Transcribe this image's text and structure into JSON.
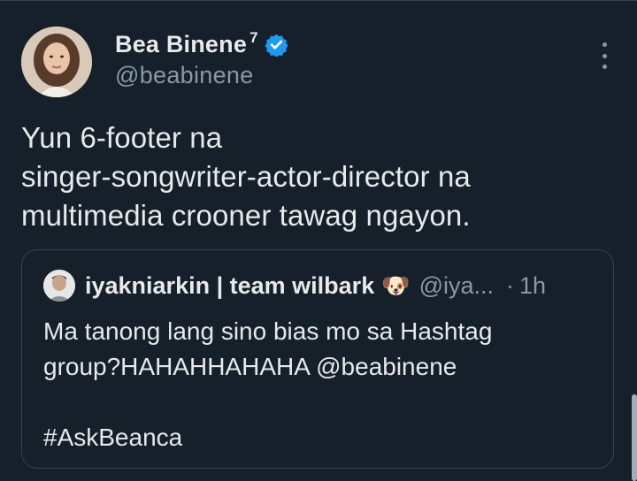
{
  "tweet": {
    "author_name": "Bea Binene",
    "author_superscript": "7",
    "author_handle": "@beabinene",
    "verified_icon": "verified-badge-icon",
    "more_icon": "more-vertical-icon",
    "text_lines": [
      "Yun 6-footer na",
      "singer-songwriter-actor-director na",
      "multimedia crooner tawag ngayon."
    ]
  },
  "quote": {
    "author_name": "iyakniarkin | team wilbark",
    "author_emoji": "🐶",
    "author_handle": "@iya...",
    "separator": "·",
    "time": "1h",
    "text_lines": [
      "Ma tanong lang sino bias mo sa Hashtag",
      "group?HAHAHHAHAHA @beabinene",
      "",
      "#AskBeanca"
    ]
  },
  "colors": {
    "background": "#15202b",
    "text": "#e7e9ea",
    "secondary": "#8b98a5",
    "border": "#38444d",
    "verified": "#1d9bf0"
  }
}
